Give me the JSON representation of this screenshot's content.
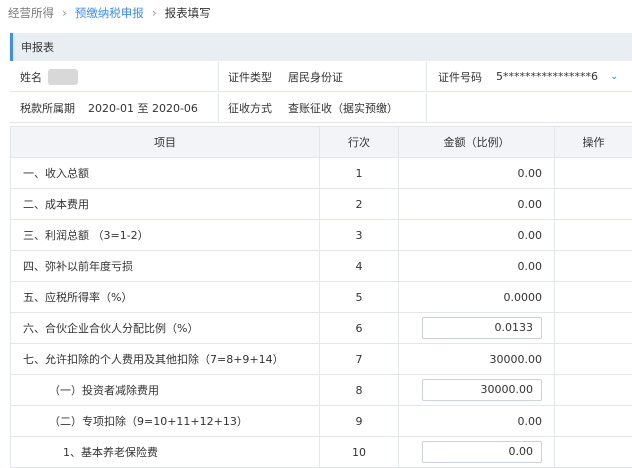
{
  "breadcrumb": {
    "item1": "经营所得",
    "item2": "预缴纳税申报",
    "item3": "报表填写"
  },
  "section": {
    "title": "申报表"
  },
  "info": {
    "name_label": "姓名",
    "id_type_label": "证件类型",
    "id_type_value": "居民身份证",
    "id_number_label": "证件号码",
    "id_number_value": "5****************6",
    "period_label": "税款所属期",
    "period_value": "2020-01 至 2020-06",
    "collection_label": "征收方式",
    "collection_value": "查账征收（据实预缴）"
  },
  "table": {
    "headers": {
      "item": "项目",
      "line": "行次",
      "amount": "金额（比例）",
      "action": "操作"
    },
    "rows": [
      {
        "item": "一、收入总额",
        "line": "1",
        "amount": "0.00",
        "editable": false,
        "indent": 0
      },
      {
        "item": "二、成本费用",
        "line": "2",
        "amount": "0.00",
        "editable": false,
        "indent": 0
      },
      {
        "item": "三、利润总额 （3=1-2）",
        "line": "3",
        "amount": "0.00",
        "editable": false,
        "indent": 0
      },
      {
        "item": "四、弥补以前年度亏损",
        "line": "4",
        "amount": "0.00",
        "editable": false,
        "indent": 0
      },
      {
        "item": "五、应税所得率（%）",
        "line": "5",
        "amount": "0.0000",
        "editable": false,
        "indent": 0
      },
      {
        "item": "六、合伙企业合伙人分配比例（%）",
        "line": "6",
        "amount": "0.0133",
        "editable": true,
        "indent": 0
      },
      {
        "item": "七、允许扣除的个人费用及其他扣除（7=8+9+14）",
        "line": "7",
        "amount": "30000.00",
        "editable": false,
        "indent": 0
      },
      {
        "item": "（一）投资者减除费用",
        "line": "8",
        "amount": "30000.00",
        "editable": true,
        "indent": 1
      },
      {
        "item": "（二）专项扣除（9=10+11+12+13）",
        "line": "9",
        "amount": "0.00",
        "editable": false,
        "indent": 1
      },
      {
        "item": "1、基本养老保险费",
        "line": "10",
        "amount": "0.00",
        "editable": true,
        "indent": 2
      }
    ]
  }
}
